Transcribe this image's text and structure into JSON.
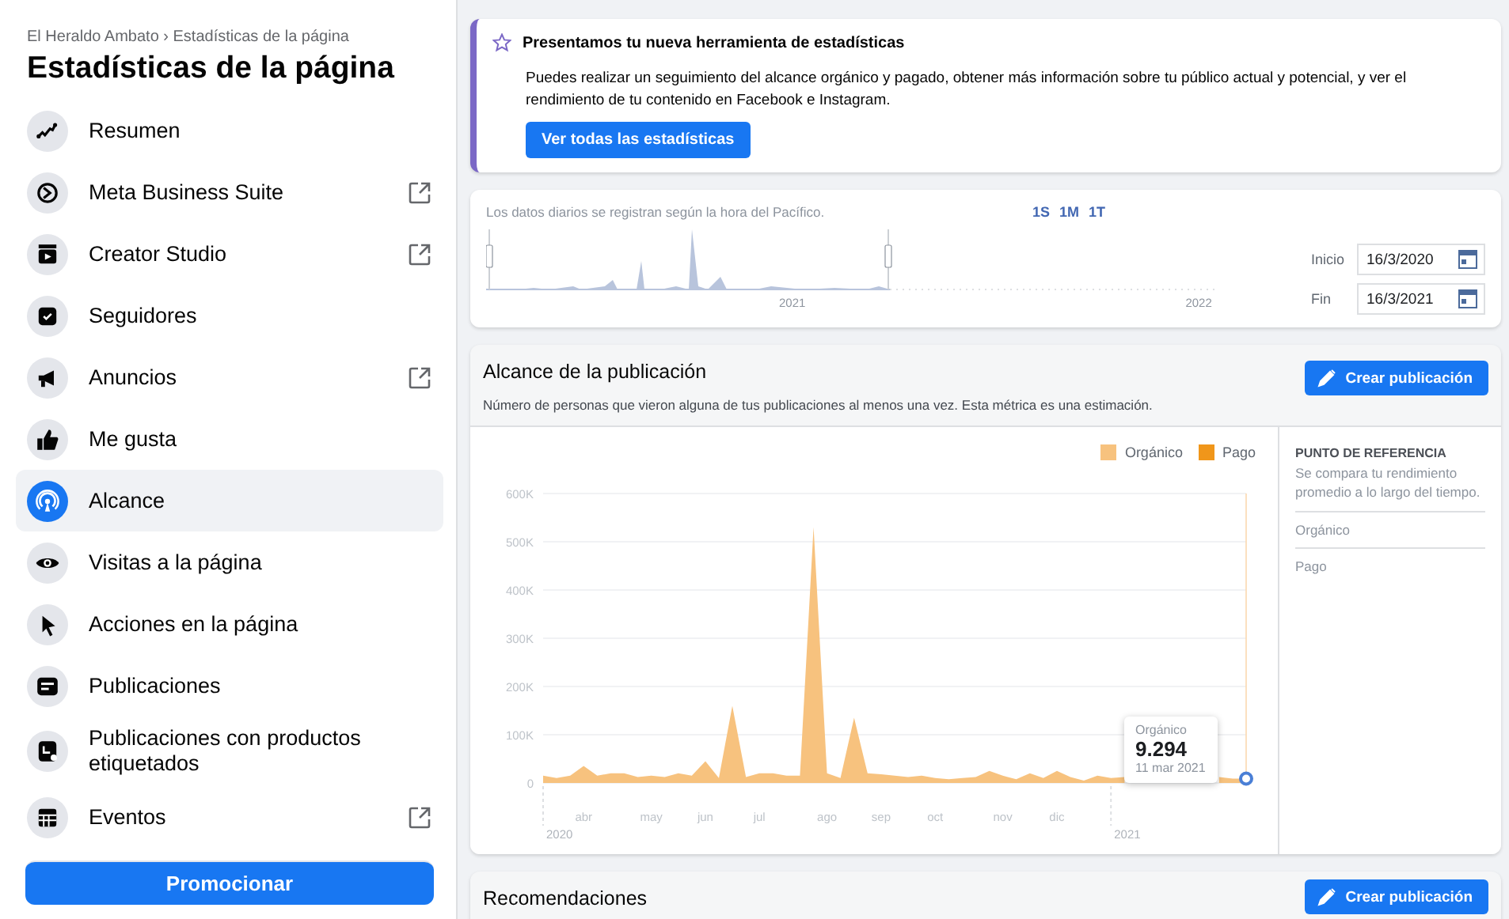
{
  "breadcrumb": "El Heraldo Ambato › Estadísticas de la página",
  "title": "Estadísticas de la página",
  "nav": [
    {
      "label": "Resumen",
      "selected": false,
      "external": false
    },
    {
      "label": "Meta Business Suite",
      "selected": false,
      "external": true
    },
    {
      "label": "Creator Studio",
      "selected": false,
      "external": true
    },
    {
      "label": "Seguidores",
      "selected": false,
      "external": false
    },
    {
      "label": "Anuncios",
      "selected": false,
      "external": true
    },
    {
      "label": "Me gusta",
      "selected": false,
      "external": false
    },
    {
      "label": "Alcance",
      "selected": true,
      "external": false
    },
    {
      "label": "Visitas a la página",
      "selected": false,
      "external": false
    },
    {
      "label": "Acciones en la página",
      "selected": false,
      "external": false
    },
    {
      "label": "Publicaciones",
      "selected": false,
      "external": false
    },
    {
      "label": "Publicaciones con productos etiquetados",
      "selected": false,
      "external": false
    },
    {
      "label": "Eventos",
      "selected": false,
      "external": true
    }
  ],
  "promote_button": "Promocionar",
  "banner": {
    "title": "Presentamos tu nueva herramienta de estadísticas",
    "text": "Puedes realizar un seguimiento del alcance orgánico y pagado, obtener más información sobre tu público actual y potencial, y ver el rendimiento de tu contenido en Facebook e Instagram.",
    "button": "Ver todas las estadísticas"
  },
  "timeline": {
    "note": "Los datos diarios se registran según la hora del Pacífico.",
    "ranges": [
      "1S",
      "1M",
      "1T"
    ],
    "year_labels": [
      "2021",
      "2022"
    ],
    "start": {
      "label": "Inicio",
      "value": "16/3/2020"
    },
    "end": {
      "label": "Fin",
      "value": "16/3/2021"
    }
  },
  "reach": {
    "title": "Alcance de la publicación",
    "subtitle": "Número de personas que vieron alguna de tus publicaciones al menos una vez. Esta métrica es una estimación.",
    "button": "Crear publicación",
    "legend_extra": [
      {
        "label": "Pago",
        "color": "#f0961a"
      }
    ],
    "chart_data": {
      "type": "area",
      "grid": true,
      "categories": [
        null,
        null,
        null,
        "abr",
        null,
        null,
        null,
        null,
        "may",
        null,
        null,
        null,
        "jun",
        null,
        null,
        null,
        "jul",
        null,
        null,
        null,
        null,
        "ago",
        null,
        null,
        null,
        "sep",
        null,
        null,
        null,
        "oct",
        null,
        null,
        null,
        null,
        "nov",
        null,
        null,
        null,
        "dic",
        null,
        null,
        null,
        null,
        null,
        null,
        null,
        null,
        null,
        null,
        null,
        null,
        null,
        null
      ],
      "series": [
        {
          "name": "Orgánico",
          "color": "#f7c27e",
          "values": [
            15000,
            10000,
            15000,
            35000,
            15000,
            20000,
            20000,
            12000,
            15000,
            12000,
            20000,
            15000,
            45000,
            10000,
            160000,
            12000,
            20000,
            20000,
            15000,
            15000,
            530000,
            20000,
            10000,
            135000,
            20000,
            18000,
            15000,
            12000,
            15000,
            10000,
            8000,
            10000,
            12000,
            25000,
            15000,
            8000,
            20000,
            10000,
            25000,
            12000,
            5000,
            15000,
            10000,
            12000,
            null,
            null,
            null,
            null,
            null,
            null,
            12000,
            9000,
            9000
          ]
        }
      ],
      "ylim": [
        0,
        600000
      ],
      "yticks": [
        {
          "value": 0,
          "label": "0"
        },
        {
          "value": 100000,
          "label": "100K"
        },
        {
          "value": 200000,
          "label": "200K"
        },
        {
          "value": 300000,
          "label": "300K"
        },
        {
          "value": 400000,
          "label": "400K"
        },
        {
          "value": 500000,
          "label": "500K"
        },
        {
          "value": 600000,
          "label": "600K"
        }
      ],
      "annotations": [
        "2020",
        "2021"
      ]
    },
    "tooltip": {
      "series": "Orgánico",
      "value": "9.294",
      "date": "11 mar 2021"
    },
    "benchmark": {
      "title": "PUNTO DE REFERENCIA",
      "text": "Se compara tu rendimiento promedio a lo largo del tiempo.",
      "items": [
        "Orgánico",
        "Pago"
      ]
    }
  },
  "recommendations": {
    "title": "Recomendaciones",
    "button": "Crear publicación"
  }
}
